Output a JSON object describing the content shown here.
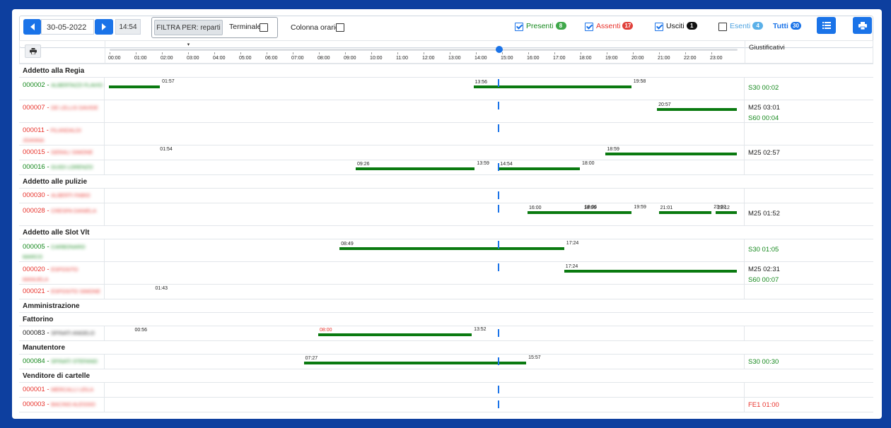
{
  "toolbar": {
    "date": "30-05-2022",
    "time": "14:54",
    "filter_label": "FILTRA PER: reparti",
    "terminale_label": "Terminale",
    "colonna_label": "Colonna orario",
    "presenti": {
      "label": "Presenti",
      "count": "8",
      "checked": true,
      "color": "#16891e"
    },
    "assenti": {
      "label": "Assenti",
      "count": "17",
      "checked": true,
      "color": "#e8332c"
    },
    "usciti": {
      "label": "Usciti",
      "count": "1",
      "checked": true,
      "color": "#111111"
    },
    "esenti": {
      "label": "Esenti",
      "count": "4",
      "checked": false,
      "color": "#4fa3e0"
    },
    "tutti": {
      "label": "Tutti",
      "count": "30",
      "color": "#1a73e8"
    }
  },
  "header": {
    "justifications_label": "Giustificativi",
    "hours": [
      "00:00",
      "01:00",
      "02:00",
      "03:00",
      "04:00",
      "05:00",
      "06:00",
      "07:00",
      "08:00",
      "09:00",
      "10:00",
      "11:00",
      "12:00",
      "13:00",
      "14:00",
      "15:00",
      "16:00",
      "17:00",
      "18:00",
      "19:00",
      "20:00",
      "21:00",
      "22:00",
      "23:00"
    ]
  },
  "rows": [
    {
      "type": "dept",
      "label": "Addetto alla Regia"
    },
    {
      "type": "emp",
      "code": "000002",
      "name": "ALBERTAZZI FLAVIO",
      "status": "green",
      "h": 32,
      "segments": [
        {
          "s": "00:00",
          "e": "01:57",
          "sl": "",
          "el": "01:57"
        },
        {
          "s": "13:56",
          "e": "19:58",
          "sl": "13:56",
          "el": "19:58"
        }
      ],
      "now": true,
      "just": [
        {
          "t": "S30 00:02",
          "c": "green"
        }
      ]
    },
    {
      "type": "emp",
      "code": "000007",
      "name": "DE LELLIS DAVIDE",
      "status": "red",
      "h": 32,
      "segments": [
        {
          "s": "20:57",
          "e": "24:00",
          "sl": "20:57",
          "el": ""
        }
      ],
      "now": true,
      "just": [
        {
          "t": "M25 03:01",
          "c": "dark"
        },
        {
          "t": "S60 00:04",
          "c": "green"
        }
      ]
    },
    {
      "type": "emp",
      "code": "000011",
      "name": "FILANDALDI JOANNA",
      "status": "red",
      "h": 32,
      "segments": [],
      "now": true,
      "just": []
    },
    {
      "type": "emp",
      "code": "000015",
      "name": "GERALI SIMONE",
      "status": "red",
      "h": 21,
      "segments": [
        {
          "s": "18:59",
          "e": "24:00",
          "sl": "18:59",
          "el": ""
        }
      ],
      "labels": [
        {
          "at": "01:54",
          "t": "01:54"
        }
      ],
      "now": false,
      "just": [
        {
          "t": "M25 02:57",
          "c": "dark"
        }
      ]
    },
    {
      "type": "emp",
      "code": "000016",
      "name": "GUIDI LORENZO",
      "status": "green",
      "h": 21,
      "segments": [
        {
          "s": "09:26",
          "e": "13:59",
          "sl": "09:26",
          "el": "13:59"
        },
        {
          "s": "14:54",
          "e": "18:00",
          "sl": "14:54",
          "el": "18:00"
        }
      ],
      "now": true,
      "just": []
    },
    {
      "type": "dept",
      "label": "Addetto alle pulizie"
    },
    {
      "type": "emp",
      "code": "000030",
      "name": "ALBERTI FABIO",
      "status": "red",
      "h": 21,
      "segments": [],
      "now": true,
      "just": []
    },
    {
      "type": "emp",
      "code": "000028",
      "name": "CRESPA DANIELA",
      "status": "red",
      "h": 32,
      "segments": [
        {
          "s": "16:00",
          "e": "18:06",
          "sl": "16:00",
          "el": "18:06"
        },
        {
          "s": "18:06",
          "e": "19:59",
          "sl": "18:06",
          "el": "19:59"
        },
        {
          "s": "21:01",
          "e": "23:02",
          "sl": "21:01",
          "el": "23:02"
        },
        {
          "s": "23:12",
          "e": "24:00",
          "sl": "23:12",
          "el": ""
        }
      ],
      "now": true,
      "just": [
        {
          "t": "M25 01:52",
          "c": "dark"
        }
      ]
    },
    {
      "type": "dept",
      "label": "Addetto alle Slot Vlt"
    },
    {
      "type": "emp",
      "code": "000005",
      "name": "CARBONARO MARCO",
      "status": "green",
      "h": 32,
      "segments": [
        {
          "s": "08:49",
          "e": "17:24",
          "sl": "08:49",
          "el": "17:24"
        }
      ],
      "now": true,
      "just": [
        {
          "t": "S30 01:05",
          "c": "green"
        }
      ]
    },
    {
      "type": "emp",
      "code": "000020",
      "name": "ESPOSITO MANUELA",
      "status": "red",
      "h": 32,
      "segments": [
        {
          "s": "17:24",
          "e": "24:00",
          "sl": "17:24",
          "el": ""
        }
      ],
      "now": true,
      "just": [
        {
          "t": "M25 02:31",
          "c": "dark"
        },
        {
          "t": "S60 00:07",
          "c": "green"
        }
      ]
    },
    {
      "type": "emp",
      "code": "000021",
      "name": "ESPOSITO SIMONE",
      "status": "red",
      "h": 21,
      "segments": [],
      "labels": [
        {
          "at": "01:43",
          "t": "01:43"
        }
      ],
      "now": false,
      "just": []
    },
    {
      "type": "dept",
      "label": "Amministrazione"
    },
    {
      "type": "dept",
      "label": "Fattorino"
    },
    {
      "type": "emp",
      "code": "000083",
      "name": "SPINATI ANGELO",
      "status": "dark",
      "h": 21,
      "segments": [
        {
          "s": "08:00",
          "e": "13:52",
          "sl": "08:00",
          "el": "13:52",
          "slred": true
        }
      ],
      "labels": [
        {
          "at": "00:56",
          "t": "00:56"
        }
      ],
      "now": true,
      "just": []
    },
    {
      "type": "dept",
      "label": "Manutentore"
    },
    {
      "type": "emp",
      "code": "000084",
      "name": "SPINATI STEFANO",
      "status": "green",
      "h": 21,
      "segments": [
        {
          "s": "07:27",
          "e": "15:57",
          "sl": "07:27",
          "el": "15:57"
        }
      ],
      "now": true,
      "just": [
        {
          "t": "S30 00:30",
          "c": "green"
        }
      ]
    },
    {
      "type": "dept",
      "label": "Venditore di cartelle"
    },
    {
      "type": "emp",
      "code": "000001",
      "name": "MERCALLI LEILA",
      "status": "red",
      "h": 21,
      "segments": [],
      "now": true,
      "just": []
    },
    {
      "type": "emp",
      "code": "000003",
      "name": "BACINO ALESSIO",
      "status": "red",
      "h": 21,
      "segments": [],
      "now": true,
      "just": [
        {
          "t": "FE1 01:00",
          "c": "red"
        }
      ]
    }
  ],
  "now_time": "14:54"
}
